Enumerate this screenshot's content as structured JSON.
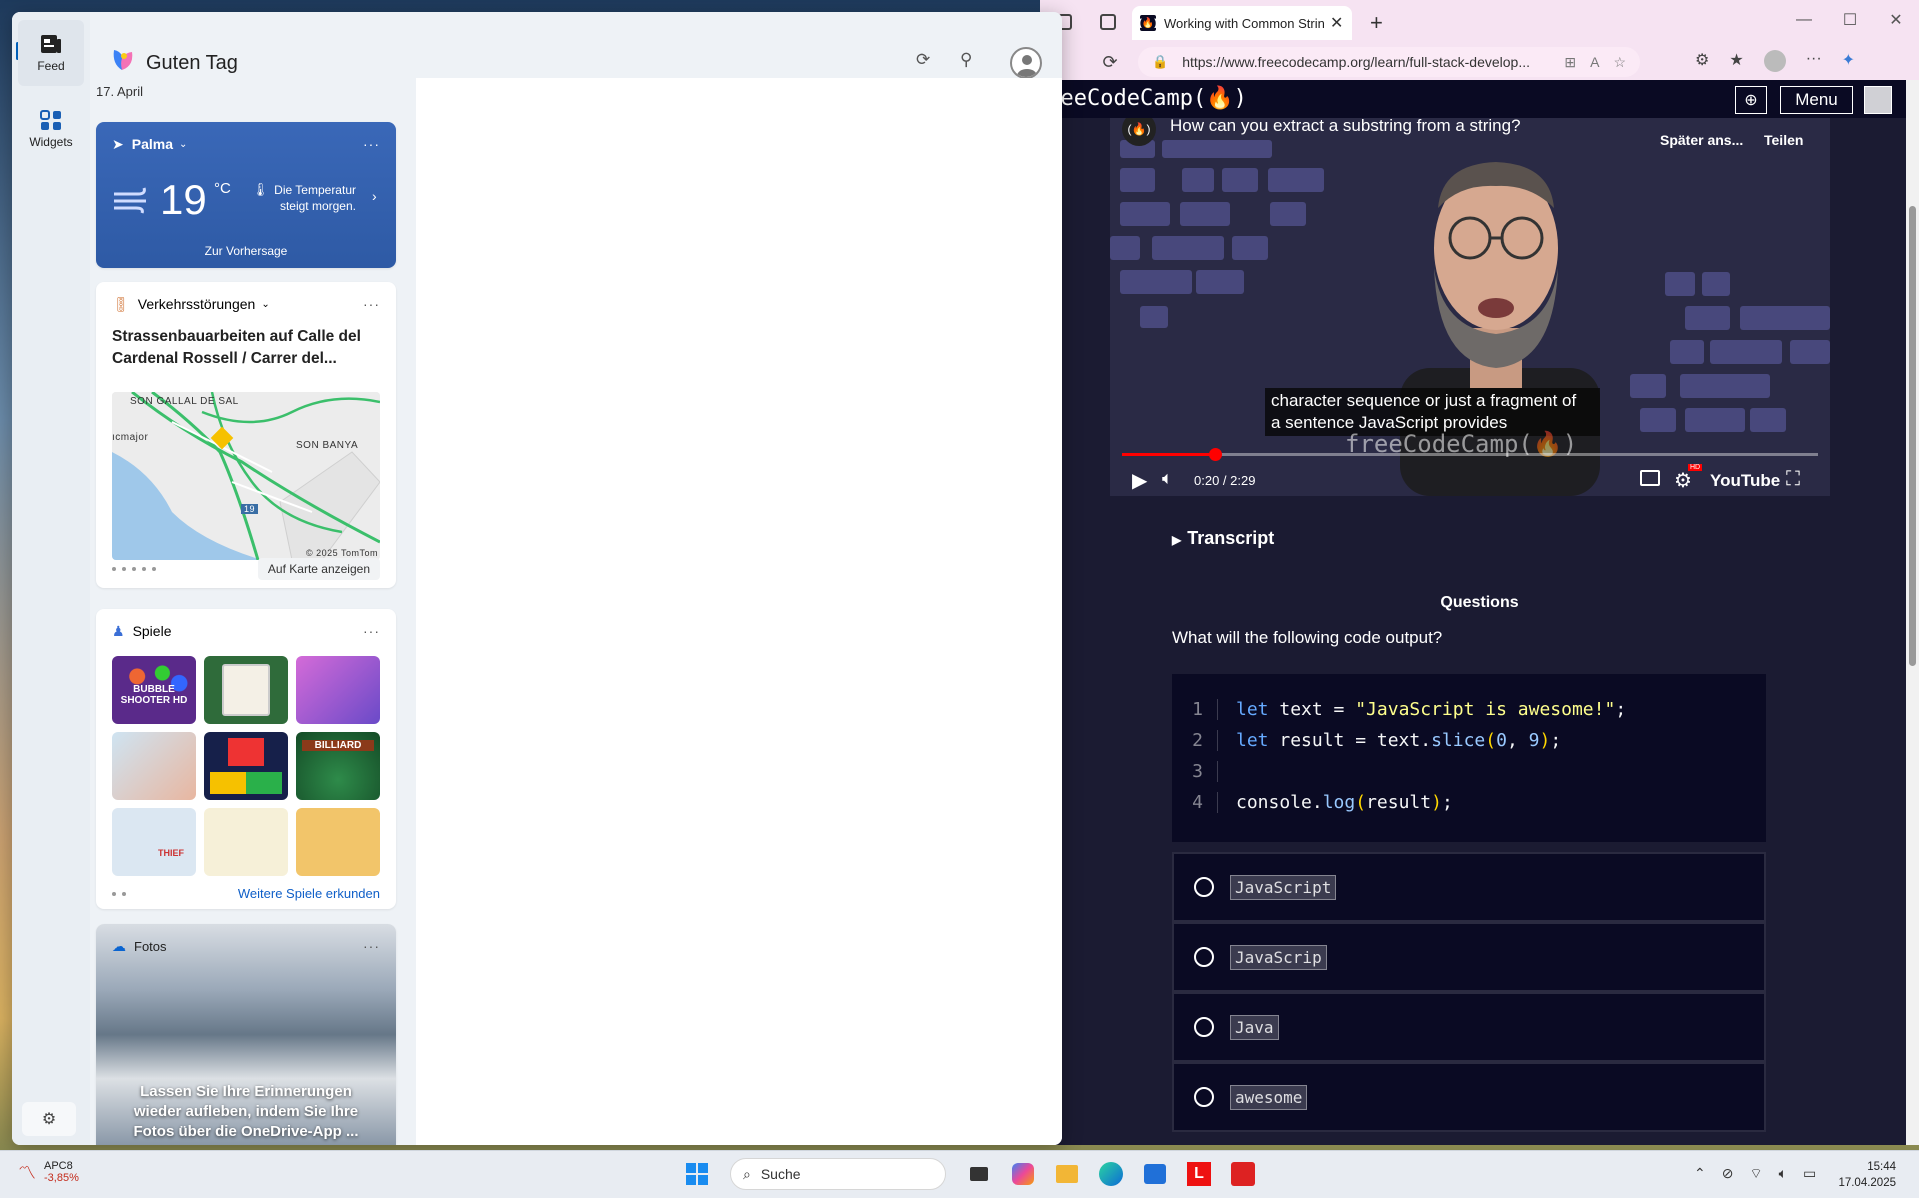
{
  "browser": {
    "tab_title": "Working with Common String Me",
    "url": "https://www.freecodecamp.org/learn/full-stack-develop...",
    "colors": {
      "nav_bg": "#0a0a23",
      "page_bg": "#1b1b32",
      "accent_red": "#ff0000"
    }
  },
  "fcc": {
    "logo": "freeCodeCamp(🔥)",
    "menu_label": "Menu",
    "globe_icon": "globe-icon",
    "video": {
      "title": "How can you extract a substring from a string?",
      "watch_later": "Später ans...",
      "share": "Teilen",
      "caption_line1": "character sequence or just a fragment of",
      "caption_line2": "a sentence JavaScript provides",
      "watermark": "freeCodeCamp(🔥)",
      "time": "0:20 / 2:29",
      "progress_fraction": 0.134,
      "youtube_label": "YouTube",
      "hd_badge": "HD"
    },
    "transcript_label": "Transcript",
    "questions_heading": "Questions",
    "question": "What will the following code output?",
    "code_line_numbers": [
      "1",
      "2",
      "3",
      "4"
    ],
    "answers": [
      "JavaScript",
      "JavaScrip",
      "Java",
      "awesome"
    ]
  },
  "widgets": {
    "rail": {
      "feed_label": "Feed",
      "widgets_label": "Widgets"
    },
    "greeting": "Guten Tag",
    "date": "17. April",
    "weather": {
      "location": "Palma",
      "temperature": "19",
      "unit": "°C",
      "note": "Die Temperatur steigt morgen.",
      "link": "Zur Vorhersage"
    },
    "traffic": {
      "title": "Verkehrsstörungen",
      "headline": "Strassenbauarbeiten auf Calle del Cardenal Rossell / Carrer del...",
      "map_labels": [
        "SON GALLAL DE SAL",
        "ıcmajor",
        "SON BANYA",
        "19",
        "© 2025 TomTom"
      ],
      "link": "Auf Karte anzeigen"
    },
    "games": {
      "title": "Spiele",
      "tiles": [
        "BUBBLE SHOOTER HD",
        "",
        "",
        "",
        "",
        "BILLIARD",
        "THIEF",
        "",
        ""
      ],
      "link": "Weitere Spiele erkunden"
    },
    "photos": {
      "title": "Fotos",
      "text": "Lassen Sie Ihre Erinnerungen wieder aufleben, indem Sie Ihre Fotos über die OneDrive-App ..."
    }
  },
  "taskbar": {
    "stock_name": "APC8",
    "stock_change": "-3,85%",
    "search_placeholder": "Suche",
    "time": "15:44",
    "date": "17.04.2025"
  }
}
